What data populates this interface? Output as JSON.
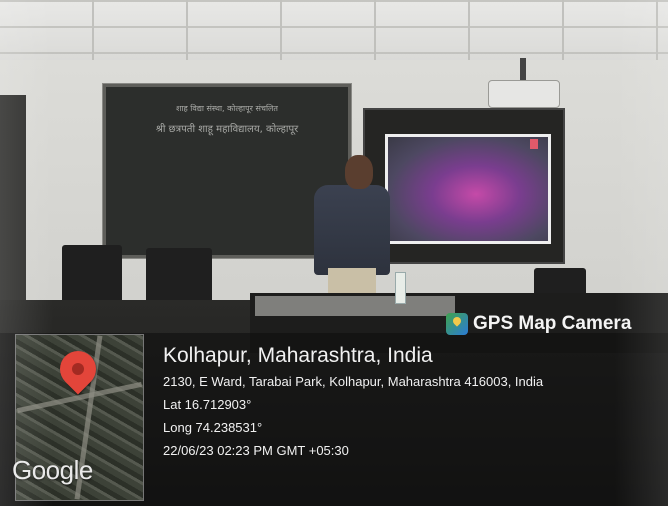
{
  "blackboard": {
    "line1": "शाह विद्या संस्था, कोल्हापूर संचलित",
    "line2": "श्री छत्रपती शाहू महाविद्यालय, कोल्हापूर"
  },
  "screen": {
    "title": ""
  },
  "stamp": {
    "app_label": "GPS Map Camera",
    "map_provider": "Google",
    "location_title": "Kolhapur, Maharashtra, India",
    "address": "2130, E Ward, Tarabai Park, Kolhapur, Maharashtra 416003, India",
    "latitude": "Lat 16.712903°",
    "longitude": "Long 74.238531°",
    "datetime": "22/06/23 02:23 PM GMT +05:30"
  },
  "colors": {
    "pin": "#e3453a",
    "overlay": "rgba(12,12,12,0.55)"
  },
  "icons": [
    "map-pin-icon",
    "gps-map-camera-icon"
  ]
}
